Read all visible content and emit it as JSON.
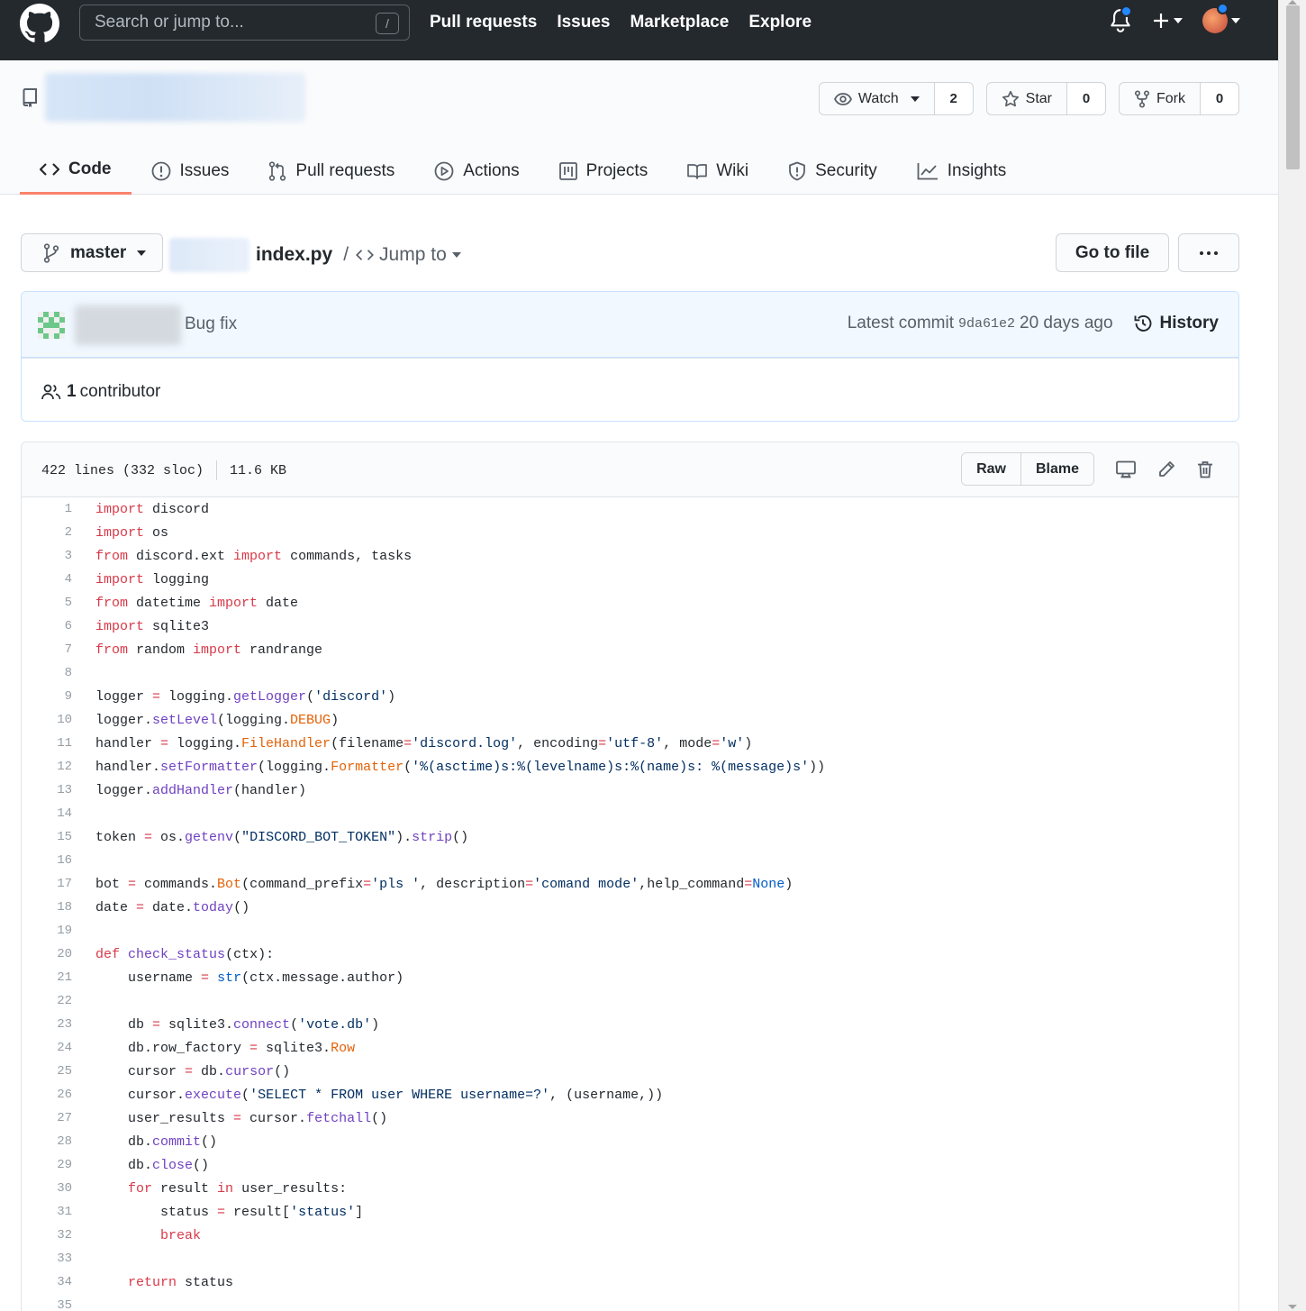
{
  "header": {
    "search_placeholder": "Search or jump to...",
    "search_shortcut": "/",
    "nav": [
      "Pull requests",
      "Issues",
      "Marketplace",
      "Explore"
    ]
  },
  "repo": {
    "watch_label": "Watch",
    "watch_count": "2",
    "star_label": "Star",
    "star_count": "0",
    "fork_label": "Fork",
    "fork_count": "0",
    "tabs": [
      "Code",
      "Issues",
      "Pull requests",
      "Actions",
      "Projects",
      "Wiki",
      "Security",
      "Insights"
    ]
  },
  "file_nav": {
    "branch": "master",
    "filename": "index.py",
    "separator": "/",
    "jump_to": "Jump to",
    "go_to_file": "Go to file"
  },
  "commit": {
    "message": "Bug fix",
    "latest_label": "Latest commit",
    "sha": "9da61e2",
    "age": "20 days ago",
    "history_label": "History",
    "contributor_count": "1",
    "contributor_label": "contributor"
  },
  "file": {
    "lines_info": "422 lines (332 sloc)",
    "size": "11.6 KB",
    "raw_label": "Raw",
    "blame_label": "Blame"
  },
  "colors": {
    "header_bg": "#24292e",
    "tab_underline": "#f9826c",
    "commit_bg": "#f1f8ff",
    "keyword": "#d73a49",
    "function": "#6f42c1",
    "string": "#032f62",
    "constant": "#005cc5",
    "class": "#e36209"
  },
  "code_lines": [
    [
      [
        "k",
        "import"
      ],
      [
        "p",
        " discord"
      ]
    ],
    [
      [
        "k",
        "import"
      ],
      [
        "p",
        " os"
      ]
    ],
    [
      [
        "k",
        "from"
      ],
      [
        "p",
        " discord.ext "
      ],
      [
        "k",
        "import"
      ],
      [
        "p",
        " commands, tasks"
      ]
    ],
    [
      [
        "k",
        "import"
      ],
      [
        "p",
        " logging"
      ]
    ],
    [
      [
        "k",
        "from"
      ],
      [
        "p",
        " datetime "
      ],
      [
        "k",
        "import"
      ],
      [
        "p",
        " date"
      ]
    ],
    [
      [
        "k",
        "import"
      ],
      [
        "p",
        " sqlite3"
      ]
    ],
    [
      [
        "k",
        "from"
      ],
      [
        "p",
        " random "
      ],
      [
        "k",
        "import"
      ],
      [
        "p",
        " randrange"
      ]
    ],
    [],
    [
      [
        "p",
        "logger "
      ],
      [
        "k",
        "="
      ],
      [
        "p",
        " logging."
      ],
      [
        "f",
        "getLogger"
      ],
      [
        "p",
        "("
      ],
      [
        "s",
        "'discord'"
      ],
      [
        "p",
        ")"
      ]
    ],
    [
      [
        "p",
        "logger."
      ],
      [
        "f",
        "setLevel"
      ],
      [
        "p",
        "(logging."
      ],
      [
        "o",
        "DEBUG"
      ],
      [
        "p",
        ")"
      ]
    ],
    [
      [
        "p",
        "handler "
      ],
      [
        "k",
        "="
      ],
      [
        "p",
        " logging."
      ],
      [
        "o",
        "FileHandler"
      ],
      [
        "p",
        "(filename"
      ],
      [
        "k",
        "="
      ],
      [
        "s",
        "'discord.log'"
      ],
      [
        "p",
        ", encoding"
      ],
      [
        "k",
        "="
      ],
      [
        "s",
        "'utf-8'"
      ],
      [
        "p",
        ", mode"
      ],
      [
        "k",
        "="
      ],
      [
        "s",
        "'w'"
      ],
      [
        "p",
        ")"
      ]
    ],
    [
      [
        "p",
        "handler."
      ],
      [
        "f",
        "setFormatter"
      ],
      [
        "p",
        "(logging."
      ],
      [
        "o",
        "Formatter"
      ],
      [
        "p",
        "("
      ],
      [
        "s",
        "'%(asctime)s:%(levelname)s:%(name)s: %(message)s'"
      ],
      [
        "p",
        "))"
      ]
    ],
    [
      [
        "p",
        "logger."
      ],
      [
        "f",
        "addHandler"
      ],
      [
        "p",
        "(handler)"
      ]
    ],
    [],
    [
      [
        "p",
        "token "
      ],
      [
        "k",
        "="
      ],
      [
        "p",
        " os."
      ],
      [
        "f",
        "getenv"
      ],
      [
        "p",
        "("
      ],
      [
        "s",
        "\"DISCORD_BOT_TOKEN\""
      ],
      [
        "p",
        ")."
      ],
      [
        "f",
        "strip"
      ],
      [
        "p",
        "()"
      ]
    ],
    [],
    [
      [
        "p",
        "bot "
      ],
      [
        "k",
        "="
      ],
      [
        "p",
        " commands."
      ],
      [
        "o",
        "Bot"
      ],
      [
        "p",
        "(command_prefix"
      ],
      [
        "k",
        "="
      ],
      [
        "s",
        "'pls '"
      ],
      [
        "p",
        ", description"
      ],
      [
        "k",
        "="
      ],
      [
        "s",
        "'comand mode'"
      ],
      [
        "p",
        ",help_command"
      ],
      [
        "k",
        "="
      ],
      [
        "c",
        "None"
      ],
      [
        "p",
        ")"
      ]
    ],
    [
      [
        "p",
        "date "
      ],
      [
        "k",
        "="
      ],
      [
        "p",
        " date."
      ],
      [
        "f",
        "today"
      ],
      [
        "p",
        "()"
      ]
    ],
    [],
    [
      [
        "k",
        "def"
      ],
      [
        "p",
        " "
      ],
      [
        "f",
        "check_status"
      ],
      [
        "p",
        "(ctx):"
      ]
    ],
    [
      [
        "p",
        "    username "
      ],
      [
        "k",
        "="
      ],
      [
        "p",
        " "
      ],
      [
        "c",
        "str"
      ],
      [
        "p",
        "(ctx.message.author)"
      ]
    ],
    [],
    [
      [
        "p",
        "    db "
      ],
      [
        "k",
        "="
      ],
      [
        "p",
        " sqlite3."
      ],
      [
        "f",
        "connect"
      ],
      [
        "p",
        "("
      ],
      [
        "s",
        "'vote.db'"
      ],
      [
        "p",
        ")"
      ]
    ],
    [
      [
        "p",
        "    db.row_factory "
      ],
      [
        "k",
        "="
      ],
      [
        "p",
        " sqlite3."
      ],
      [
        "o",
        "Row"
      ]
    ],
    [
      [
        "p",
        "    cursor "
      ],
      [
        "k",
        "="
      ],
      [
        "p",
        " db."
      ],
      [
        "f",
        "cursor"
      ],
      [
        "p",
        "()"
      ]
    ],
    [
      [
        "p",
        "    cursor."
      ],
      [
        "f",
        "execute"
      ],
      [
        "p",
        "("
      ],
      [
        "s",
        "'SELECT * FROM user WHERE username=?'"
      ],
      [
        "p",
        ", (username,))"
      ]
    ],
    [
      [
        "p",
        "    user_results "
      ],
      [
        "k",
        "="
      ],
      [
        "p",
        " cursor."
      ],
      [
        "f",
        "fetchall"
      ],
      [
        "p",
        "()"
      ]
    ],
    [
      [
        "p",
        "    db."
      ],
      [
        "f",
        "commit"
      ],
      [
        "p",
        "()"
      ]
    ],
    [
      [
        "p",
        "    db."
      ],
      [
        "f",
        "close"
      ],
      [
        "p",
        "()"
      ]
    ],
    [
      [
        "p",
        "    "
      ],
      [
        "k",
        "for"
      ],
      [
        "p",
        " result "
      ],
      [
        "k",
        "in"
      ],
      [
        "p",
        " user_results:"
      ]
    ],
    [
      [
        "p",
        "        status "
      ],
      [
        "k",
        "="
      ],
      [
        "p",
        " result["
      ],
      [
        "s",
        "'status'"
      ],
      [
        "p",
        "]"
      ]
    ],
    [
      [
        "p",
        "        "
      ],
      [
        "k",
        "break"
      ]
    ],
    [],
    [
      [
        "p",
        "    "
      ],
      [
        "k",
        "return"
      ],
      [
        "p",
        " status"
      ]
    ],
    []
  ]
}
